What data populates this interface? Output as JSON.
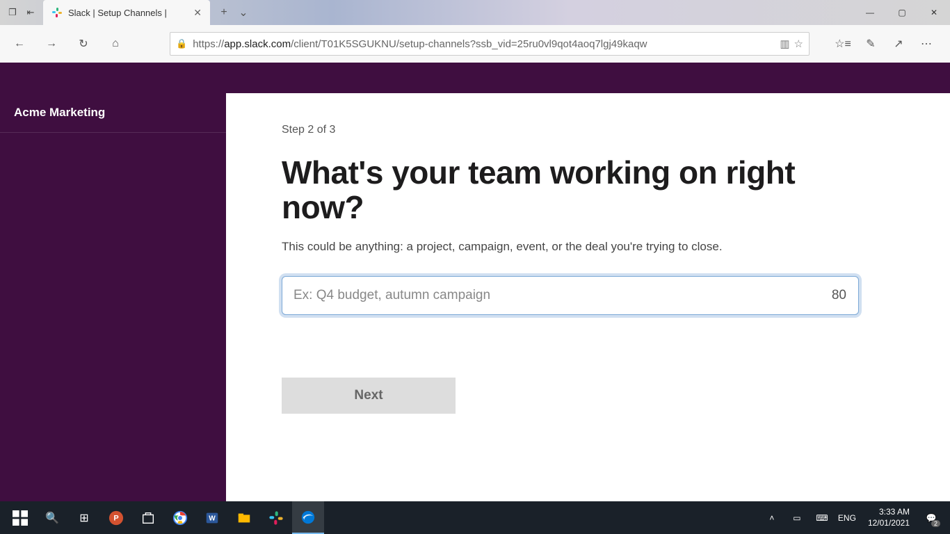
{
  "browser": {
    "tab_title": "Slack | Setup Channels |",
    "url_prefix": "https://",
    "url_host": "app.slack.com",
    "url_path": "/client/T01K5SGUKNU/setup-channels?ssb_vid=25ru0vl9qot4aoq7lgj49kaqw"
  },
  "slack": {
    "workspace_name": "Acme Marketing",
    "step_label": "Step 2 of 3",
    "heading": "What's your team working on right now?",
    "subtext": "This could be anything: a project, campaign, event, or the deal you're trying to close.",
    "input_placeholder": "Ex: Q4 budget, autumn campaign",
    "input_value": "",
    "char_limit": "80",
    "next_label": "Next"
  },
  "taskbar": {
    "lang": "ENG",
    "time": "3:33 AM",
    "date": "12/01/2021",
    "notif_count": "2"
  }
}
